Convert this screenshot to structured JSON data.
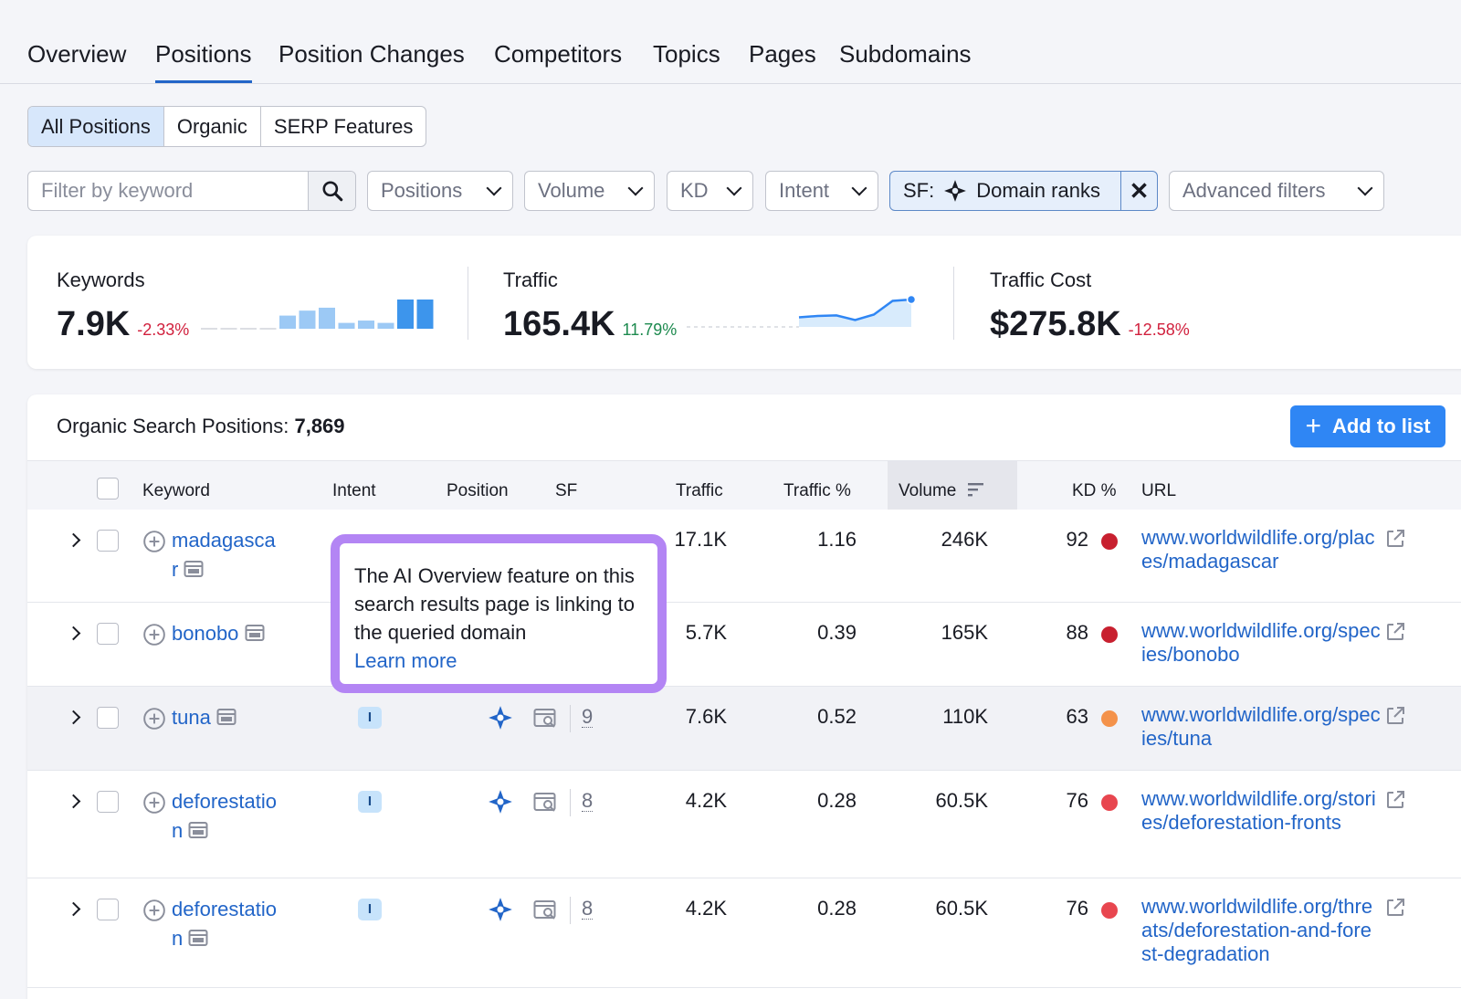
{
  "tabs": [
    {
      "label": "Overview"
    },
    {
      "label": "Positions",
      "active": true
    },
    {
      "label": "Position Changes"
    },
    {
      "label": "Competitors"
    },
    {
      "label": "Topics"
    },
    {
      "label": "Pages"
    },
    {
      "label": "Subdomains"
    }
  ],
  "segments": [
    "All Positions",
    "Organic",
    "SERP Features"
  ],
  "filters": {
    "keyword_placeholder": "Filter by keyword",
    "positions": "Positions",
    "volume": "Volume",
    "kd": "KD",
    "intent": "Intent",
    "sf_prefix": "SF:",
    "sf_value": "Domain ranks",
    "advanced": "Advanced filters"
  },
  "summary": {
    "keywords": {
      "label": "Keywords",
      "value": "7.9K",
      "change": "-2.33%"
    },
    "traffic": {
      "label": "Traffic",
      "value": "165.4K",
      "change": "11.79%"
    },
    "traffic_cost": {
      "label": "Traffic Cost",
      "value": "$275.8K",
      "change": "-12.58%"
    }
  },
  "keyword_bars": [
    0,
    0,
    0,
    0,
    0.45,
    0.62,
    0.72,
    0.2,
    0.28,
    0.2,
    1,
    1
  ],
  "traffic_series": [
    0,
    0,
    0,
    0,
    0,
    0,
    0.35,
    0.4,
    0.42,
    0.25,
    0.45,
    0.95,
    1
  ],
  "panel": {
    "title": "Organic Search Positions:",
    "count": "7,869",
    "add_button": "Add to list"
  },
  "columns": {
    "keyword": "Keyword",
    "intent": "Intent",
    "position": "Position",
    "sf": "SF",
    "traffic": "Traffic",
    "traffic_pct": "Traffic %",
    "volume": "Volume",
    "kd": "KD %",
    "url": "URL"
  },
  "rows": [
    {
      "kw1": "madagasca",
      "kw2": "r",
      "intent": "",
      "sf": "",
      "traffic": "17.1K",
      "traffic_pct": "1.16",
      "volume": "246K",
      "kd": "92",
      "kd_color": "#c8202f",
      "url": "www.worldwildlife.org/places/madagascar"
    },
    {
      "kw1": "bonobo",
      "kw2": "",
      "intent": "",
      "sf": "",
      "traffic": "5.7K",
      "traffic_pct": "0.39",
      "volume": "165K",
      "kd": "88",
      "kd_color": "#c8202f",
      "url": "www.worldwildlife.org/species/bonobo"
    },
    {
      "kw1": "tuna",
      "kw2": "",
      "intent": "I",
      "sf": "9",
      "traffic": "7.6K",
      "traffic_pct": "0.52",
      "volume": "110K",
      "kd": "63",
      "kd_color": "#f4924a",
      "url": "www.worldwildlife.org/species/tuna"
    },
    {
      "kw1": "deforestatio",
      "kw2": "n",
      "intent": "I",
      "sf": "8",
      "traffic": "4.2K",
      "traffic_pct": "0.28",
      "volume": "60.5K",
      "kd": "76",
      "kd_color": "#e8464f",
      "url": "www.worldwildlife.org/stories/deforestation-fronts"
    },
    {
      "kw1": "deforestatio",
      "kw2": "n",
      "intent": "I",
      "sf": "8",
      "traffic": "4.2K",
      "traffic_pct": "0.28",
      "volume": "60.5K",
      "kd": "76",
      "kd_color": "#e8464f",
      "url": "www.worldwildlife.org/threats/deforestation-and-forest-degradation"
    }
  ],
  "tooltip": {
    "text": "The AI Overview feature on this search results page is linking to the queried domain",
    "link": "Learn more"
  },
  "colors": {
    "accent": "#2265c8",
    "button": "#2f86f4",
    "tooltip_border": "#b385f4"
  }
}
